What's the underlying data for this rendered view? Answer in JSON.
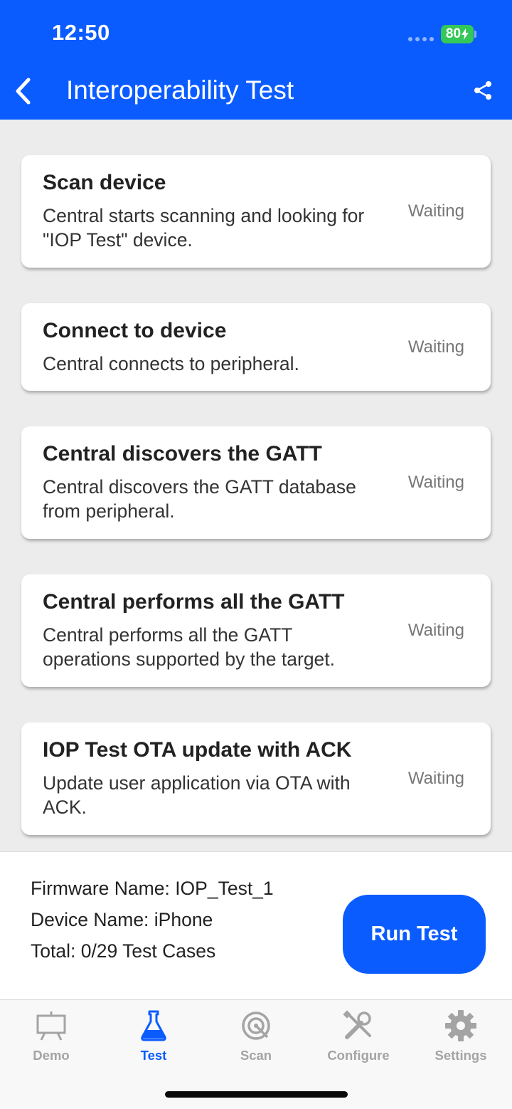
{
  "status_bar": {
    "time": "12:50",
    "battery": "80"
  },
  "header": {
    "title": "Interoperability Test"
  },
  "tests": [
    {
      "title": "Scan device",
      "description": "Central starts scanning and looking for \"IOP Test\" device.",
      "status": "Waiting"
    },
    {
      "title": "Connect to device",
      "description": "Central connects to peripheral.",
      "status": "Waiting"
    },
    {
      "title": "Central discovers the GATT",
      "description": "Central discovers the GATT database from peripheral.",
      "status": "Waiting"
    },
    {
      "title": "Central performs all the GATT",
      "description": "Central performs all the GATT operations supported by the target.",
      "status": "Waiting"
    },
    {
      "title": "IOP Test OTA update with ACK",
      "description": "Update user application via OTA with ACK.",
      "status": "Waiting"
    }
  ],
  "info": {
    "firmware": "Firmware Name: IOP_Test_1",
    "device": "Device Name: iPhone",
    "total": "Total: 0/29 Test Cases"
  },
  "run_button": "Run Test",
  "tabs": [
    {
      "label": "Demo",
      "icon": "presentation-board-icon",
      "active": false
    },
    {
      "label": "Test",
      "icon": "flask-icon",
      "active": true
    },
    {
      "label": "Scan",
      "icon": "target-scan-icon",
      "active": false
    },
    {
      "label": "Configure",
      "icon": "tools-icon",
      "active": false
    },
    {
      "label": "Settings",
      "icon": "gear-icon",
      "active": false
    }
  ],
  "colors": {
    "accent": "#0b5cff",
    "battery": "#34c759",
    "inactive_tab": "#a4a4a4"
  }
}
